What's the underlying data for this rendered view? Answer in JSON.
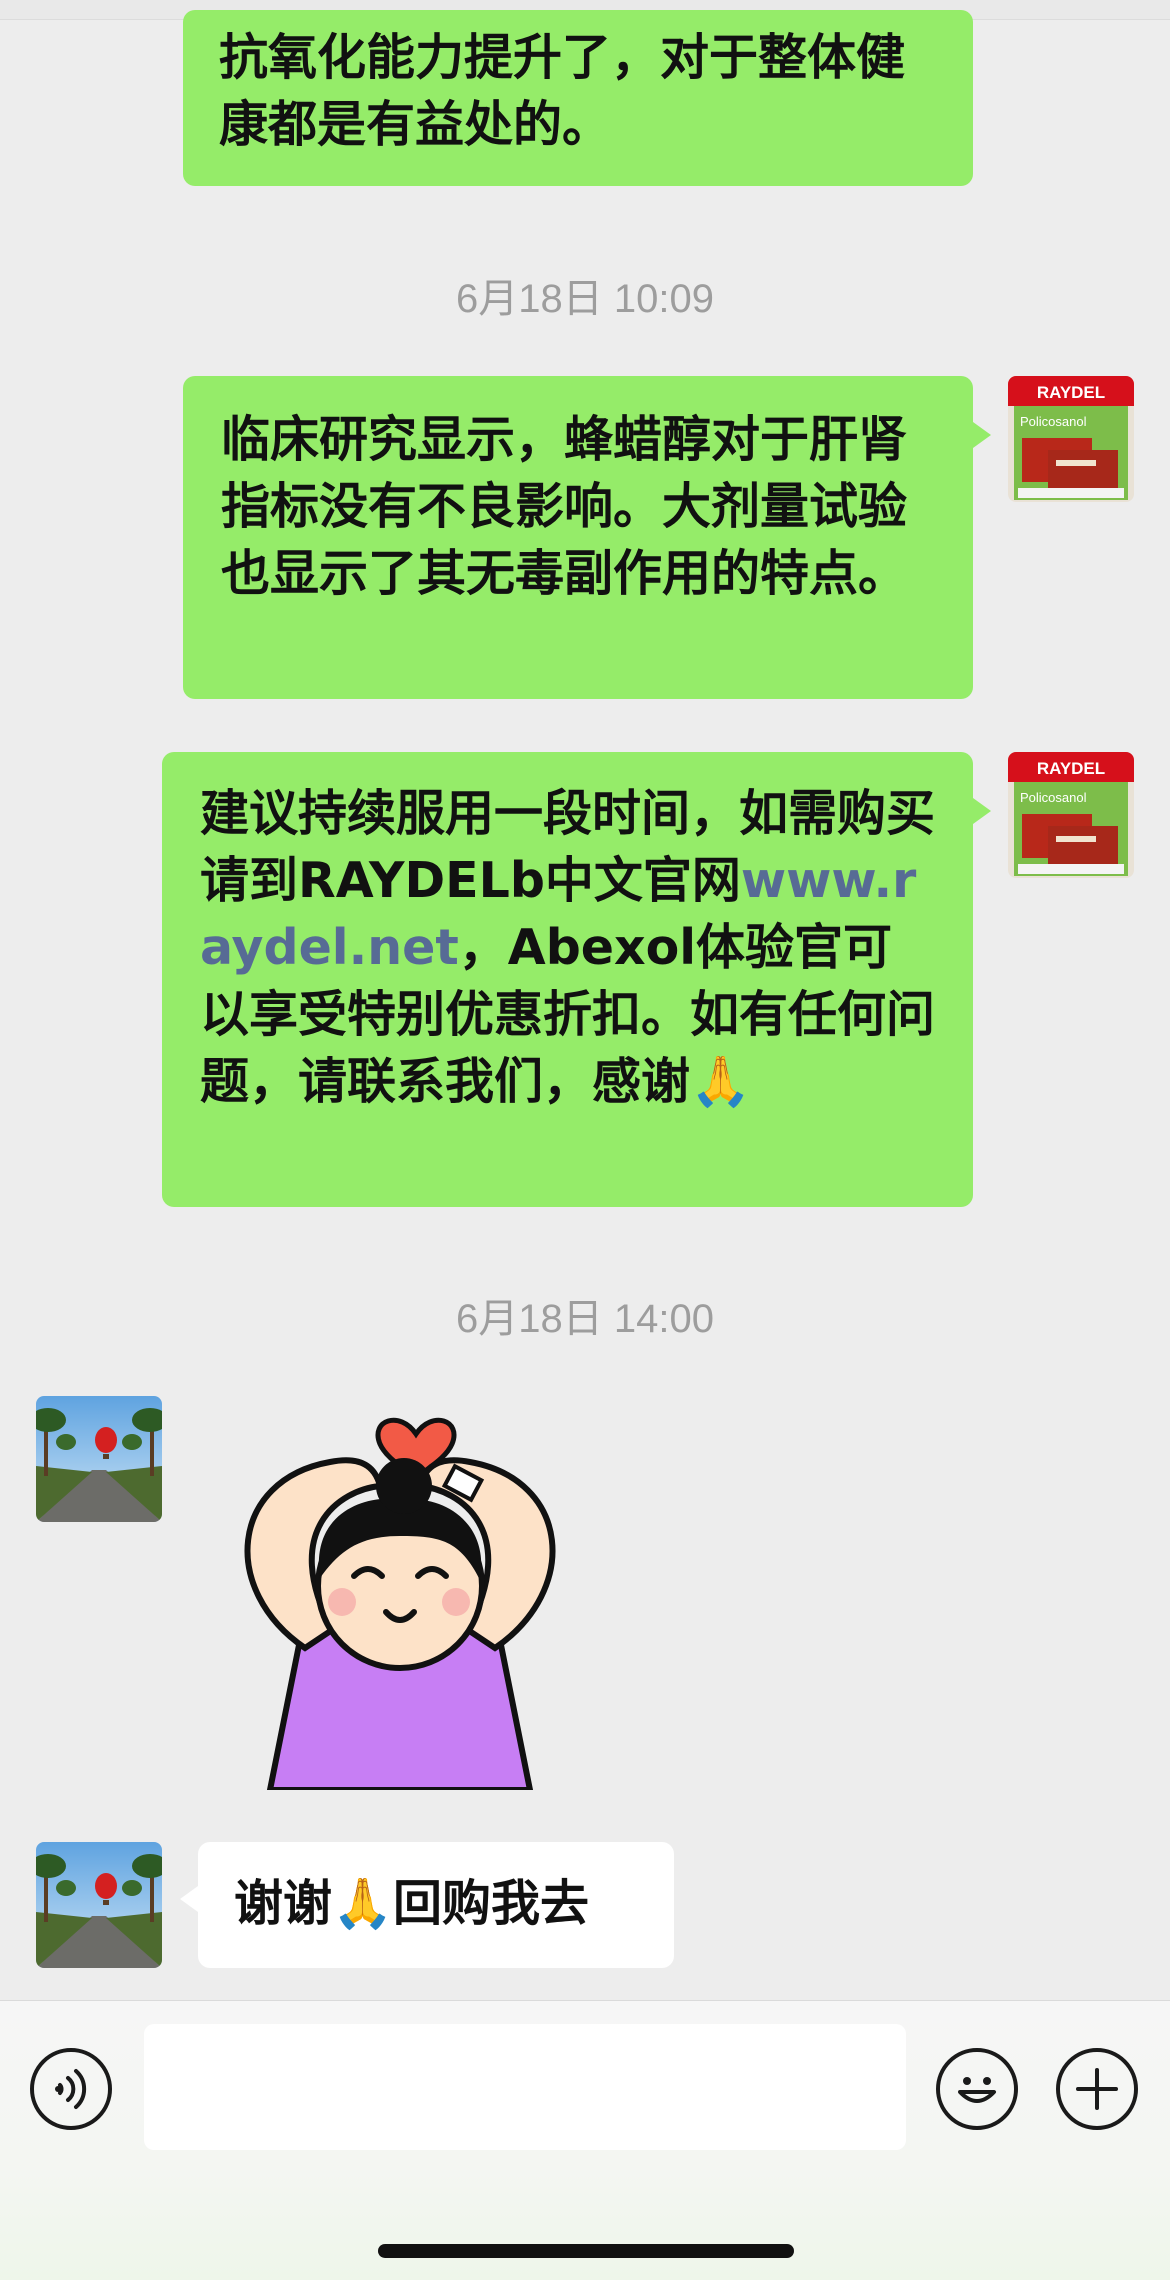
{
  "chat": {
    "messages": [
      {
        "id": "m1",
        "direction": "out",
        "text": "抗氧化能力提升了，对于整体健康都是有益处的。"
      },
      {
        "id": "ts1",
        "type": "timestamp",
        "text": "6月18日 10:09"
      },
      {
        "id": "m2",
        "direction": "out",
        "text": "临床研究显示，蜂蜡醇对于肝肾指标没有不良影响。大剂量试验也显示了其无毒副作用的特点。"
      },
      {
        "id": "m3",
        "direction": "out",
        "text_before": "建议持续服用一段时间，如需购买请到RAYDELb中文官网",
        "link": "www.raydel.net",
        "text_after": "，Abexol体验官可以享受特别优惠折扣。如有任何问题，请联系我们，感谢🙏"
      },
      {
        "id": "ts2",
        "type": "timestamp",
        "text": "6月18日 14:00"
      },
      {
        "id": "m4",
        "direction": "in",
        "type": "sticker",
        "sticker": "girl-heart-arms-sticker"
      },
      {
        "id": "m5",
        "direction": "in",
        "text": "谢谢🙏回购我去"
      }
    ],
    "sender_avatar": {
      "brand_text": "RAYDEL",
      "product_text": "Policosanol"
    },
    "receiver_avatar": {
      "icon": "hot-air-balloon-road-photo"
    }
  },
  "input_bar": {
    "voice_icon": "voice-icon",
    "emoji_icon": "emoji-icon",
    "plus_icon": "plus-icon",
    "input_value": ""
  },
  "colors": {
    "background": "#ededed",
    "outgoing_bubble": "#95ec69",
    "incoming_bubble": "#ffffff",
    "link": "#576b95",
    "timestamp": "#9d9d9d"
  }
}
